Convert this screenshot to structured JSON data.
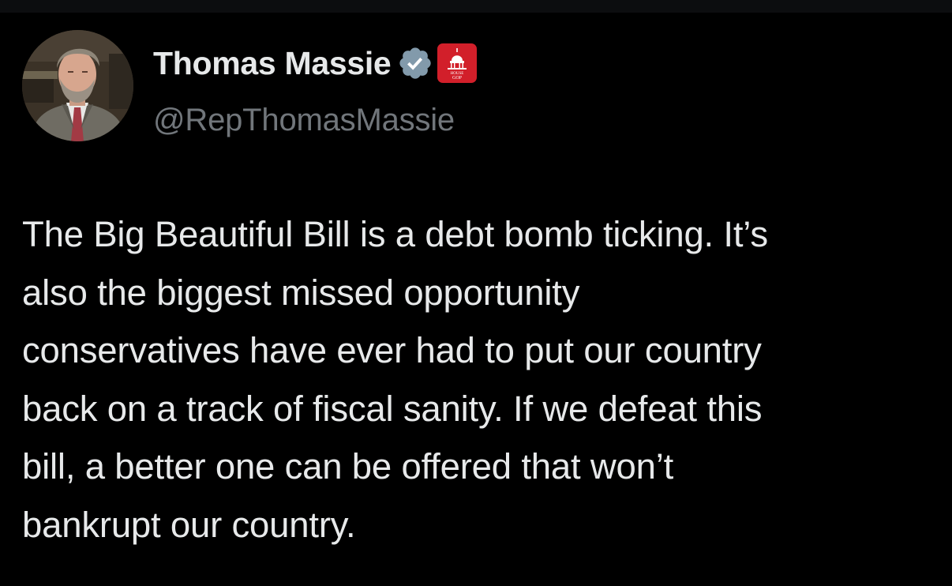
{
  "tweet": {
    "author": {
      "display_name": "Thomas Massie",
      "handle": "@RepThomasMassie",
      "verified_icon": "verified-badge-icon",
      "affiliate_badge_icon": "house-gop-capitol-icon",
      "affiliate_badge_text": "HOUSE GOP",
      "avatar": "profile-photo"
    },
    "text": "The Big Beautiful Bill is a debt bomb ticking. It’s\nalso the biggest missed opportunity\nconservatives have ever had to put our country\nback on a track of fiscal sanity. If we defeat this\nbill, a better one can be offered that won’t\nbankrupt our country."
  },
  "colors": {
    "background": "#000000",
    "primary_text": "#e7e9ea",
    "secondary_text": "#71767b",
    "verified_badge": "#829aab",
    "affiliate_badge": "#d21f2a"
  }
}
